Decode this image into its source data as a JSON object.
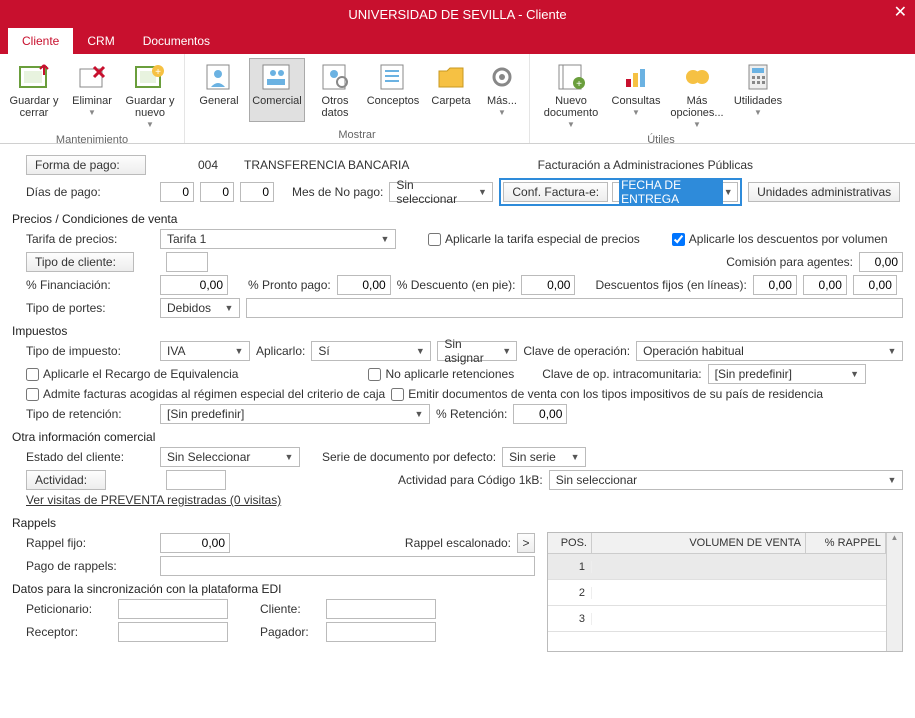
{
  "window": {
    "title": "UNIVERSIDAD DE SEVILLA - Cliente"
  },
  "tabs": {
    "cliente": "Cliente",
    "crm": "CRM",
    "documentos": "Documentos"
  },
  "ribbon": {
    "mantenimiento": {
      "label": "Mantenimiento",
      "guardar_cerrar": "Guardar y cerrar",
      "eliminar": "Eliminar",
      "guardar_nuevo": "Guardar y nuevo"
    },
    "mostrar": {
      "label": "Mostrar",
      "general": "General",
      "comercial": "Comercial",
      "otros_datos": "Otros datos",
      "conceptos": "Conceptos",
      "carpeta": "Carpeta",
      "mas": "Más..."
    },
    "utiles": {
      "label": "Útiles",
      "nuevo_documento": "Nuevo documento",
      "consultas": "Consultas",
      "mas_opciones": "Más opciones...",
      "utilidades": "Utilidades"
    }
  },
  "form": {
    "forma_pago_label": "Forma de pago:",
    "forma_pago_code": "004",
    "forma_pago_text": "TRANSFERENCIA BANCARIA",
    "facturacion_admin_label": "Facturación a Administraciones Públicas",
    "dias_pago_label": "Días de pago:",
    "dias_pago": [
      "0",
      "0",
      "0"
    ],
    "mes_no_pago_label": "Mes de No pago:",
    "mes_no_pago_value": "Sin seleccionar",
    "conf_facturae_label": "Conf. Factura-e:",
    "conf_facturae_value": "FECHA DE ENTREGA",
    "unidades_admin_btn": "Unidades administrativas"
  },
  "precios": {
    "section": "Precios / Condiciones de venta",
    "tarifa_label": "Tarifa de precios:",
    "tarifa_value": "Tarifa 1",
    "chk_tarifa_especial": "Aplicarle la tarifa especial de precios",
    "chk_descuentos_vol": "Aplicarle los descuentos por volumen",
    "tipo_cliente_btn": "Tipo de cliente:",
    "comision_label": "Comisión para agentes:",
    "comision_value": "0,00",
    "financiacion_label": "% Financiación:",
    "financiacion_value": "0,00",
    "pronto_pago_label": "% Pronto pago:",
    "pronto_pago_value": "0,00",
    "descuento_pie_label": "% Descuento (en pie):",
    "descuento_pie_value": "0,00",
    "descuentos_fijos_label": "Descuentos fijos (en líneas):",
    "descuentos_fijos": [
      "0,00",
      "0,00",
      "0,00"
    ],
    "tipo_portes_label": "Tipo de portes:",
    "tipo_portes_value": "Debidos"
  },
  "impuestos": {
    "section": "Impuestos",
    "tipo_impuesto_label": "Tipo de impuesto:",
    "tipo_impuesto_value": "IVA",
    "aplicarlo_label": "Aplicarlo:",
    "aplicarlo_value": "Sí",
    "sin_asignar": "Sin asignar",
    "clave_op_label": "Clave de operación:",
    "clave_op_value": "Operación habitual",
    "chk_recargo": "Aplicarle el Recargo de Equivalencia",
    "chk_no_ret": "No aplicarle retenciones",
    "clave_intracom_label": "Clave de op. intracomunitaria:",
    "clave_intracom_value": "[Sin predefinir]",
    "chk_criterio_caja": "Admite facturas acogidas al régimen especial del criterio de caja",
    "chk_emitir_docs": "Emitir documentos de venta con los tipos impositivos de su país de residencia",
    "tipo_retencion_label": "Tipo de retención:",
    "tipo_retencion_value": "[Sin predefinir]",
    "pct_retencion_label": "% Retención:",
    "pct_retencion_value": "0,00"
  },
  "otra": {
    "section": "Otra información comercial",
    "estado_label": "Estado del cliente:",
    "estado_value": "Sin Seleccionar",
    "serie_label": "Serie de documento por defecto:",
    "serie_value": "Sin serie",
    "actividad_btn": "Actividad:",
    "actividad_codigo_label": "Actividad para Código 1kB:",
    "actividad_codigo_value": "Sin seleccionar",
    "visitas_link": "Ver visitas de PREVENTA registradas (0 visitas)"
  },
  "rappels": {
    "section": "Rappels",
    "rappel_fijo_label": "Rappel fijo:",
    "rappel_fijo_value": "0,00",
    "rappel_escalonado_label": "Rappel escalonado:",
    "pago_label": "Pago de rappels:",
    "table_headers": {
      "pos": "POS.",
      "vol": "VOLUMEN DE VENTA",
      "pct": "% RAPPEL"
    },
    "table_rows": [
      "1",
      "2",
      "3"
    ]
  },
  "edi": {
    "section": "Datos para la sincronización con la plataforma EDI",
    "peticionario": "Peticionario:",
    "cliente": "Cliente:",
    "receptor": "Receptor:",
    "pagador": "Pagador:"
  }
}
